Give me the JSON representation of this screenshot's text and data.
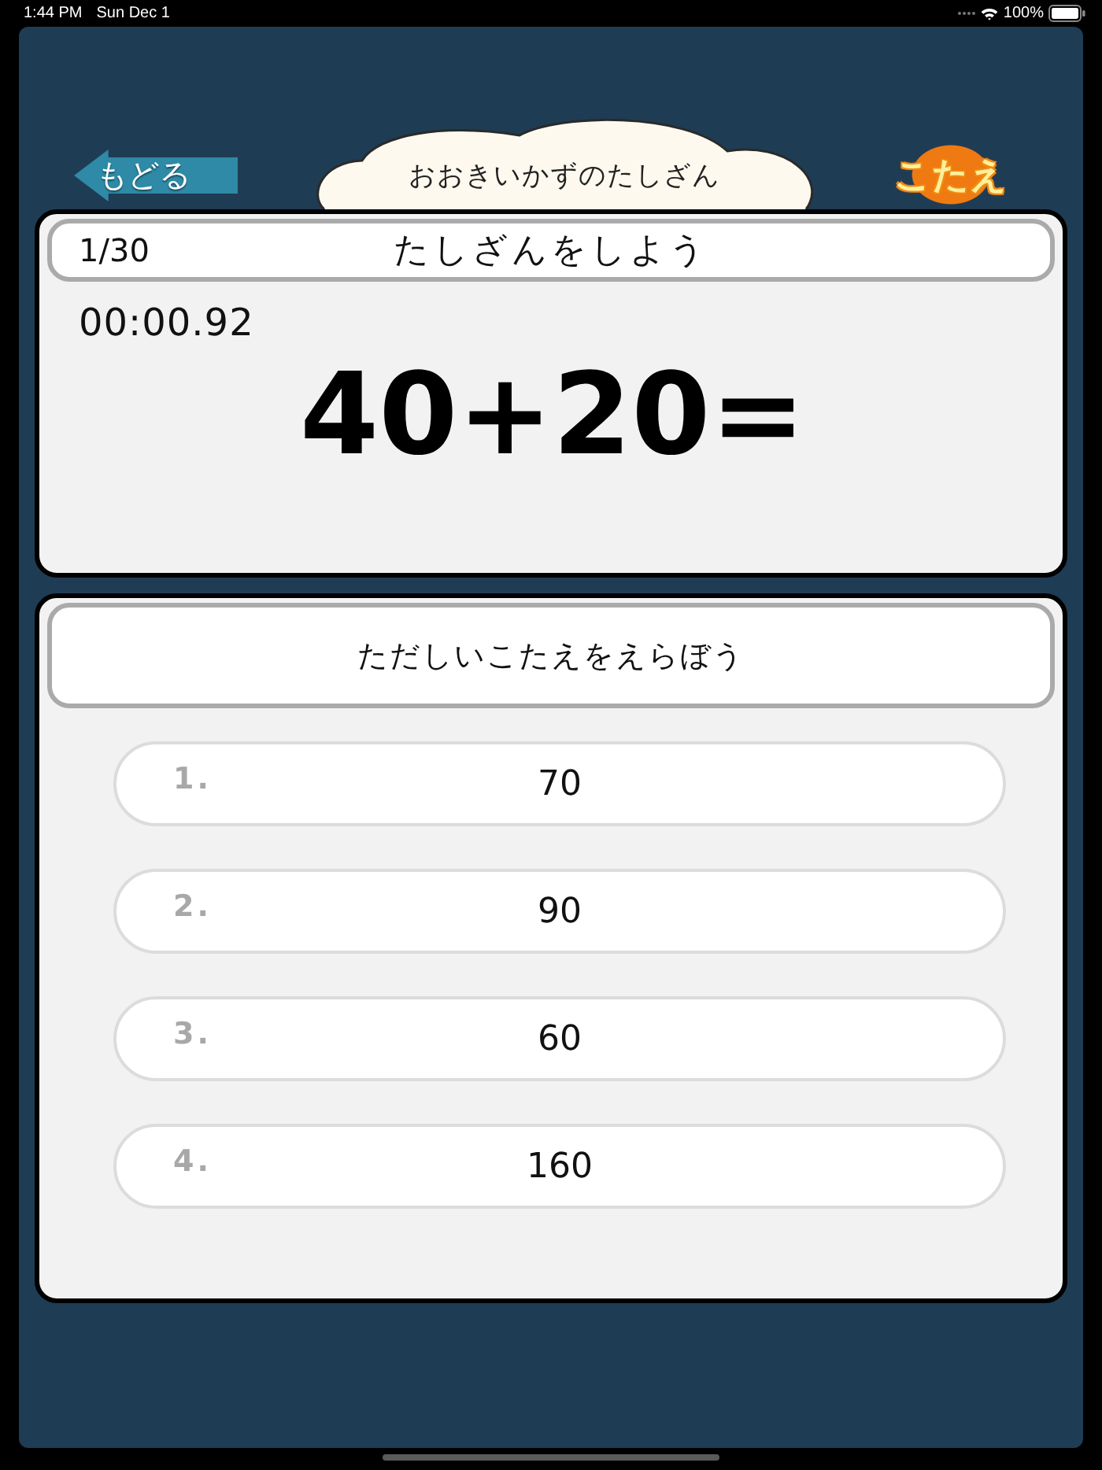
{
  "status_bar": {
    "time": "1:44 PM",
    "date": "Sun Dec 1",
    "battery": "100%"
  },
  "header": {
    "back_label": "もどる",
    "title": "おおきいかずのたしざん",
    "answer_label": "こたえ"
  },
  "question": {
    "progress": "1/30",
    "instruction": "たしざんをしよう",
    "timer": "00:00.92",
    "expression": "40+20="
  },
  "answers": {
    "instruction": "ただしいこたえをえらぼう",
    "choices": [
      {
        "number": "1.",
        "value": "70"
      },
      {
        "number": "2.",
        "value": "90"
      },
      {
        "number": "3.",
        "value": "60"
      },
      {
        "number": "4.",
        "value": "160"
      }
    ]
  }
}
